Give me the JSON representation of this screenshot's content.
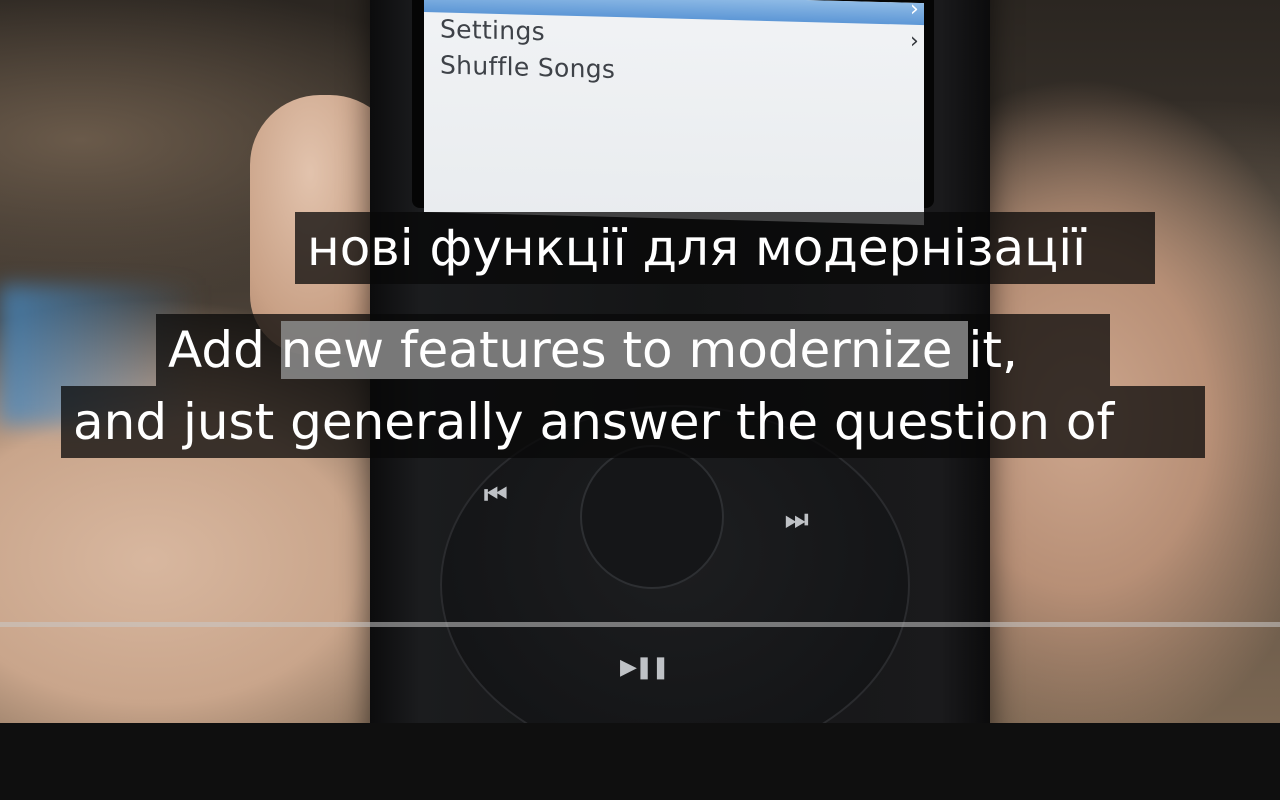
{
  "video": {
    "screen_menu": {
      "items": [
        {
          "label": "Settings",
          "chevron": "›"
        },
        {
          "label": "Shuffle Songs",
          "chevron": ""
        }
      ],
      "highlight_chevron": "›"
    },
    "wheel": {
      "prev_icon": "⏮",
      "next_icon": "⏭",
      "playpause_icon": "▶❚❚"
    }
  },
  "captions": {
    "translated_line": "нові функції для модернізації",
    "line1_before": "Add ",
    "line1_highlight": "new features to modernize ",
    "line1_after": "it,",
    "line2": "and just generally answer the question of"
  },
  "colors": {
    "caption_bg": "#080808",
    "caption_highlight": "#8c8c8c",
    "screen_highlight": "#5d97d6",
    "control_bar": "#0f0f0f"
  }
}
